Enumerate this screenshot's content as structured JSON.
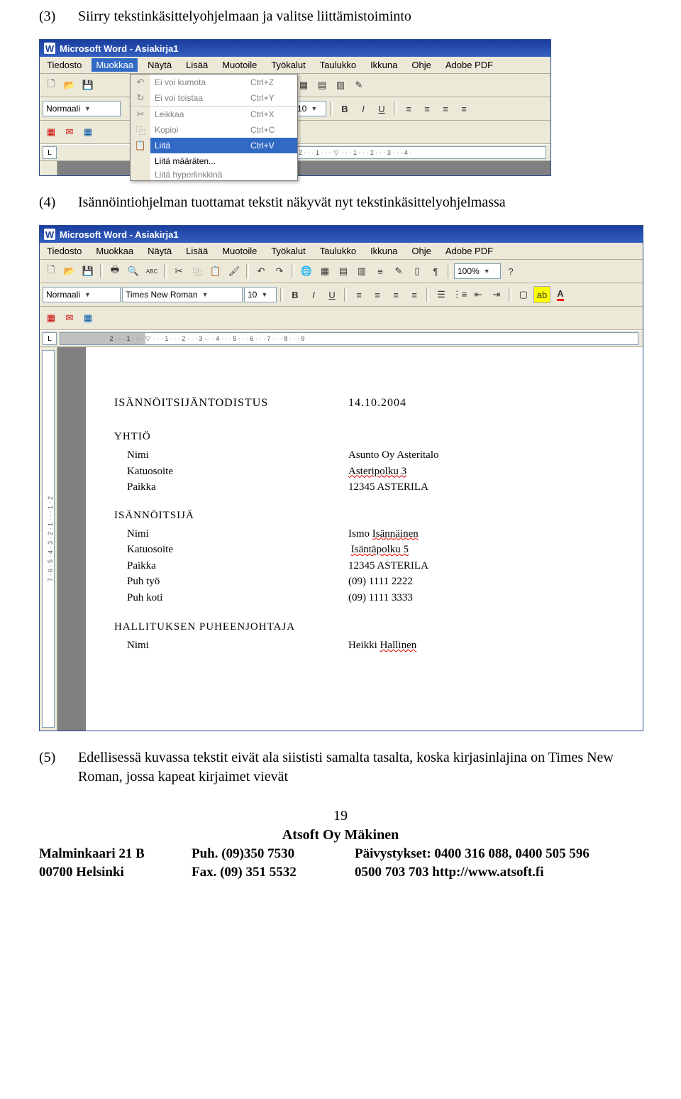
{
  "step3_num": "(3)",
  "step3_text": "Siirry tekstinkäsittelyohjelmaan ja valitse liittämistoiminto",
  "step4_num": "(4)",
  "step4_text": "Isännöintiohjelman tuottamat tekstit näkyvät nyt tekstinkäsittelyohjelmassa",
  "step5_num": "(5)",
  "step5_text": "Edellisessä kuvassa tekstit eivät ala siististi samalta tasalta, koska kirjasinlajina on Times New Roman, jossa kapeat kirjaimet vievät",
  "word": {
    "title": "Microsoft Word - Asiakirja1",
    "menus": {
      "tiedosto": "Tiedosto",
      "muokkaa": "Muokkaa",
      "nayta": "Näytä",
      "lisaa": "Lisää",
      "muotoile": "Muotoile",
      "tyokalut": "Työkalut",
      "taulukko": "Taulukko",
      "ikkuna": "Ikkuna",
      "ohje": "Ohje",
      "adobepdf": "Adobe PDF"
    },
    "style": "Normaali",
    "font": "Times New Roman",
    "size": "10",
    "zoom": "100%",
    "ruler_l": "L",
    "edit_menu": {
      "undo": "Ei voi kumota",
      "undo_sc": "Ctrl+Z",
      "redo": "Ei voi toistaa",
      "redo_sc": "Ctrl+Y",
      "cut": "Leikkaa",
      "cut_sc": "Ctrl+X",
      "copy": "Kopioi",
      "copy_sc": "Ctrl+C",
      "paste": "Liitä",
      "paste_sc": "Ctrl+V",
      "paste_special": "Liitä määräten...",
      "paste_hyper": "Liitä hyperlinkkinä"
    }
  },
  "doc": {
    "title": "ISÄNNÖITSIJÄNTODISTUS",
    "date": "14.10.2004",
    "yhtio_h": "YHTIÖ",
    "yhtio": {
      "nimi_l": "Nimi",
      "nimi_v": "Asunto Oy Asteritalo",
      "katu_l": "Katuosoite",
      "katu_v": "Asteripolku 3",
      "paikka_l": "Paikka",
      "paikka_v": "12345 ASTERILA"
    },
    "isan_h": "ISÄNNÖITSIJÄ",
    "isan": {
      "nimi_l": "Nimi",
      "nimi_v": "Ismo Isännäinen",
      "katu_l": "Katuosoite",
      "katu_v": "Isäntäpolku 5",
      "paikka_l": "Paikka",
      "paikka_v": "12345 ASTERILA",
      "ptyo_l": "Puh työ",
      "ptyo_v": "(09) 1111 2222",
      "pkoti_l": "Puh koti",
      "pkoti_v": "(09) 1111 3333"
    },
    "hall_h": "HALLITUKSEN PUHEENJOHTAJA",
    "hall": {
      "nimi_l": "Nimi",
      "nimi_v": "Heikki Hallinen"
    }
  },
  "footer": {
    "page": "19",
    "company": "Atsoft Oy Mäkinen",
    "addr1": "Malminkaari 21 B",
    "addr2": "00700 Helsinki",
    "puh": "Puh. (09)350 7530",
    "fax": "Fax. (09) 351 5532",
    "paiv1": "Päivystykset: 0400 316 088, 0400 505 596",
    "paiv2": "0500 703 703     http://www.atsoft.fi"
  }
}
